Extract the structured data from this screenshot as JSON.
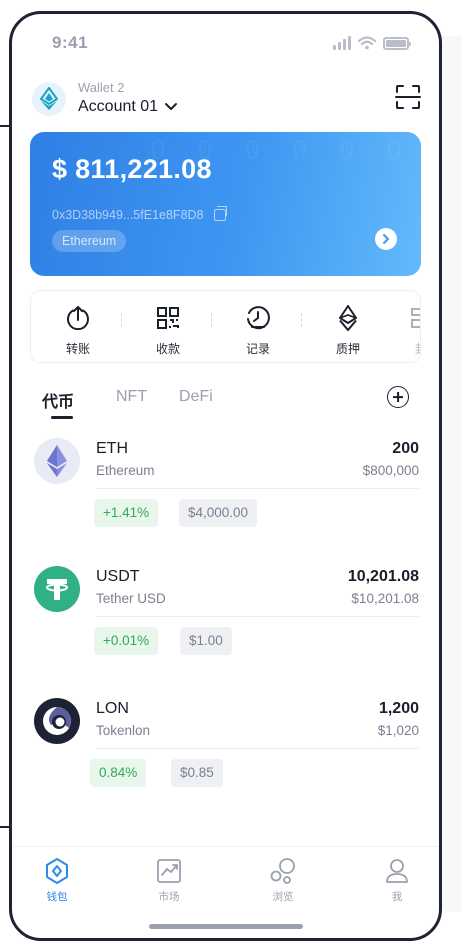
{
  "status_bar": {
    "time": "9:41"
  },
  "wallet": {
    "name": "Wallet 2",
    "account": "Account 01"
  },
  "card": {
    "balance": "$ 811,221.08",
    "address": "0x3D38b949...5fE1e8F8D8",
    "network": "Ethereum",
    "background_pattern": "0 0 0 0 0 0 0 0 0 0 0 0 0 0 0 0 0 0 0 0"
  },
  "actions": [
    {
      "label": "转账",
      "icon": "transfer-icon"
    },
    {
      "label": "收款",
      "icon": "qr-code-icon"
    },
    {
      "label": "记录",
      "icon": "history-icon"
    },
    {
      "label": "质押",
      "icon": "ethereum-stake-icon"
    },
    {
      "label": "封",
      "icon": "more-action-icon"
    }
  ],
  "tabs": [
    {
      "label": "代币",
      "active": true
    },
    {
      "label": "NFT",
      "active": false
    },
    {
      "label": "DeFi",
      "active": false
    }
  ],
  "tokens": [
    {
      "symbol": "ETH",
      "name": "Ethereum",
      "amount": "200",
      "value": "$800,000",
      "change": "+1.41%",
      "price": "$4,000.00",
      "icon": "ethereum-icon"
    },
    {
      "symbol": "USDT",
      "name": "Tether USD",
      "amount": "10,201.08",
      "value": "$10,201.08",
      "change": "+0.01%",
      "price": "$1.00",
      "icon": "tether-icon"
    },
    {
      "symbol": "LON",
      "name": "Tokenlon",
      "amount": "1,200",
      "value": "$1,020",
      "change": "0.84%",
      "price": "$0.85",
      "icon": "tokenlon-icon"
    }
  ],
  "bottom_nav": [
    {
      "label": "钱包",
      "icon": "wallet-icon",
      "active": true
    },
    {
      "label": "市场",
      "icon": "market-chart-icon",
      "active": false
    },
    {
      "label": "浏览",
      "icon": "browse-icon",
      "active": false
    },
    {
      "label": "我",
      "icon": "profile-icon",
      "active": false
    }
  ],
  "colors": {
    "accent": "#2c8be8",
    "card_gradient_start": "#2f7fe4",
    "card_gradient_end": "#63bafb",
    "positive": "#2eab55",
    "text_primary": "#1b1e2b",
    "text_secondary": "#7a8090"
  }
}
